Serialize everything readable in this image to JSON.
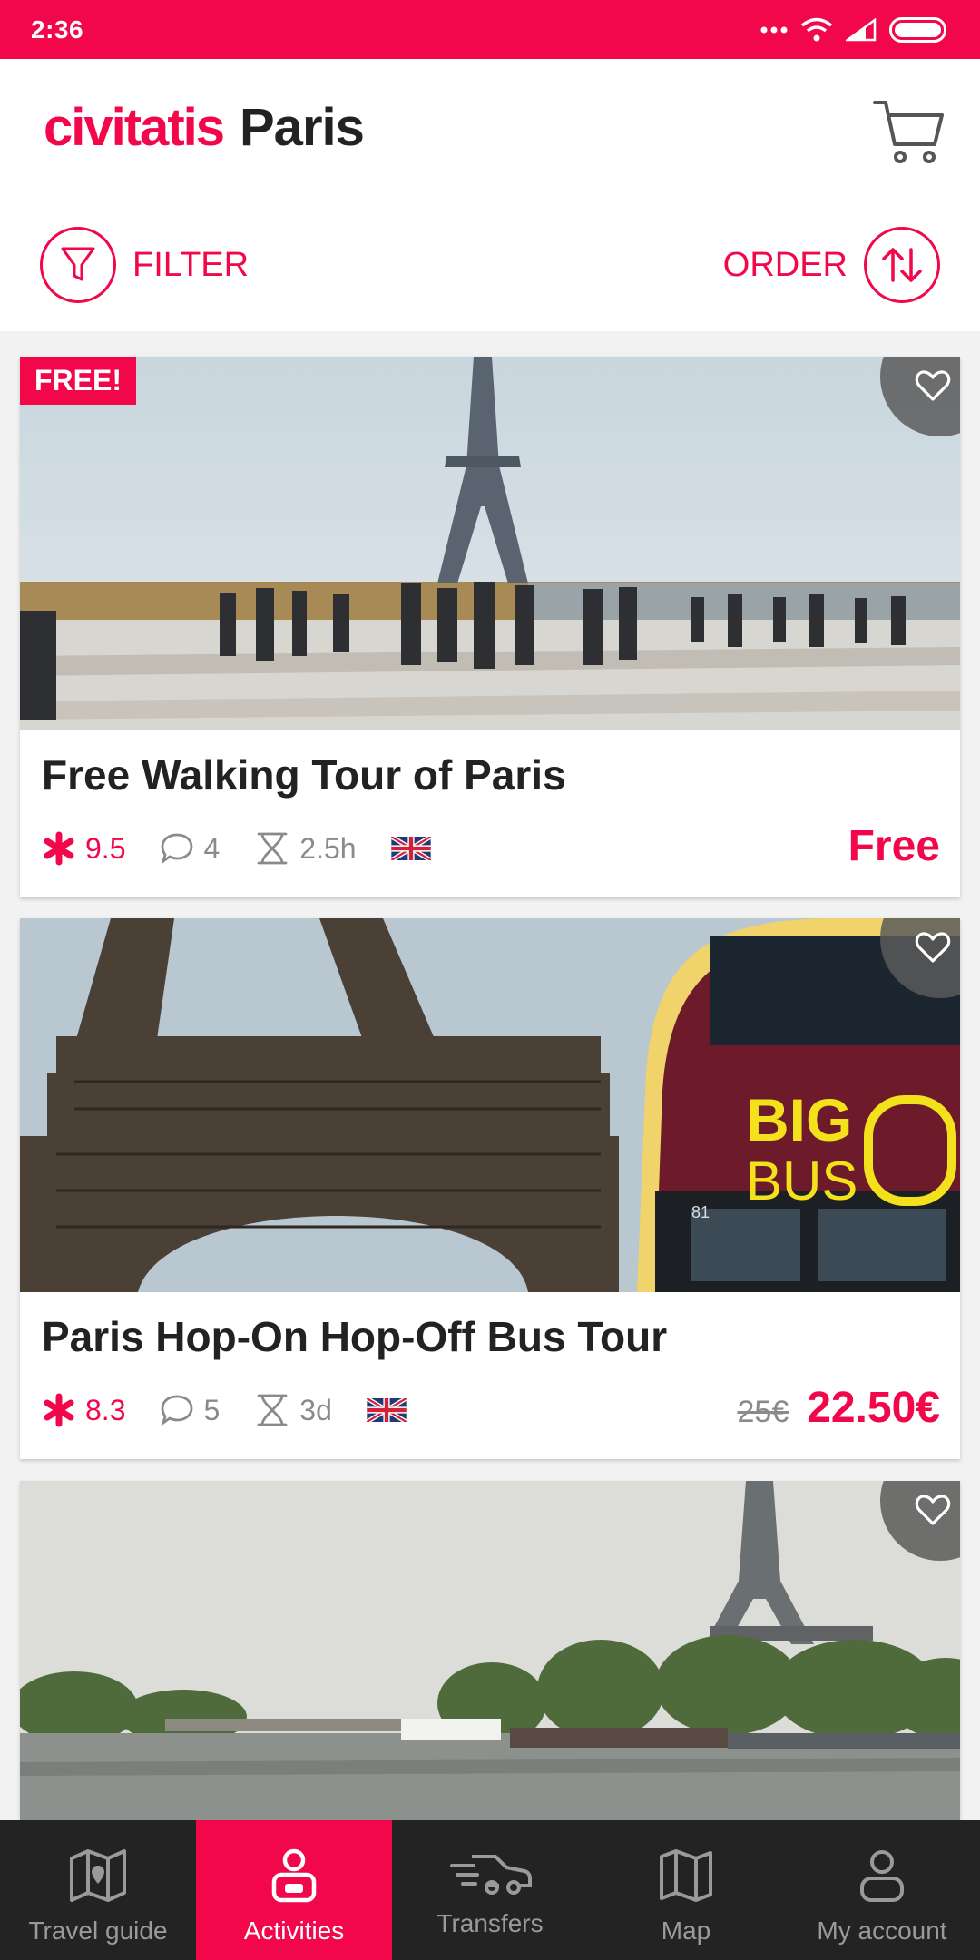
{
  "status_bar": {
    "time": "2:36"
  },
  "header": {
    "brand": "civitatis",
    "city": "Paris",
    "filter_label": "FILTER",
    "order_label": "ORDER"
  },
  "cards": [
    {
      "badge": "FREE!",
      "title": "Free Walking Tour of Paris",
      "rating": "9.5",
      "reviews": "4",
      "duration": "2.5h",
      "language": "uk-flag",
      "old_price": "",
      "price": "Free"
    },
    {
      "badge": "",
      "title": "Paris Hop-On Hop-Off Bus Tour",
      "rating": "8.3",
      "reviews": "5",
      "duration": "3d",
      "language": "uk-flag",
      "old_price": "25€",
      "price": "22.50€",
      "image_text": {
        "line1": "BIG",
        "line2": "BUS",
        "bus_number": "81"
      }
    },
    {
      "badge": "",
      "title": "",
      "rating": "",
      "reviews": "",
      "duration": "",
      "language": "",
      "old_price": "",
      "price": ""
    }
  ],
  "bottom_nav": [
    {
      "label": "Travel guide",
      "icon": "map-book-icon",
      "active": false
    },
    {
      "label": "Activities",
      "icon": "person-icon",
      "active": true
    },
    {
      "label": "Transfers",
      "icon": "car-icon",
      "active": false
    },
    {
      "label": "Map",
      "icon": "map-icon",
      "active": false
    },
    {
      "label": "My account",
      "icon": "account-icon",
      "active": false
    }
  ],
  "colors": {
    "accent": "#f2074b",
    "nav_bg": "#232323",
    "text": "#222222",
    "muted": "#8a8a8a"
  }
}
